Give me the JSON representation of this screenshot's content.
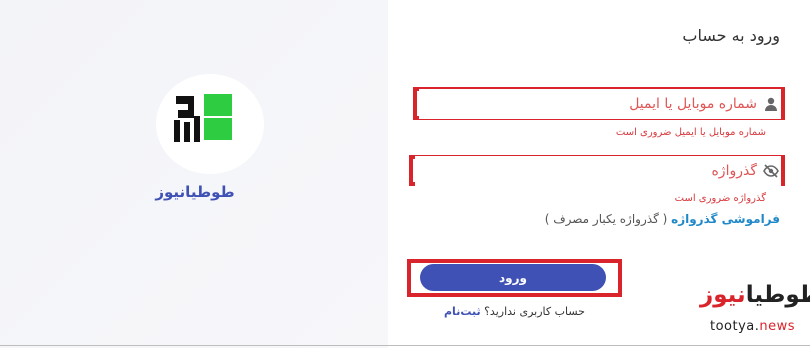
{
  "brand": {
    "name": "طوطیانیوز"
  },
  "form": {
    "title": "ورود به حساب",
    "username": {
      "placeholder": "شماره موبایل یا ایمیل",
      "value": "",
      "error": "شماره موبایل یا ایمیل ضروری است",
      "icon": "person-icon"
    },
    "password": {
      "placeholder": "گذرواژه",
      "value": "",
      "error": "گذرواژه ضروری است",
      "icon": "eye-off-icon"
    },
    "forgot": {
      "link": "فراموشی گذرواژه",
      "hint": "( گذرواژه یکبار مصرف )"
    },
    "submit_label": "ورود",
    "signup": {
      "text": "حساب کاربری ندارید؟",
      "link": "ثبت‌نام"
    }
  },
  "watermark": {
    "fa_dark": "طوطیا",
    "fa_red": "نیوز",
    "en_dark": "tootya.",
    "en_red": "news"
  },
  "colors": {
    "accent": "#3f51b5",
    "error": "#d9242b",
    "link": "#1e88c8",
    "logo_green": "#2ecc40"
  }
}
